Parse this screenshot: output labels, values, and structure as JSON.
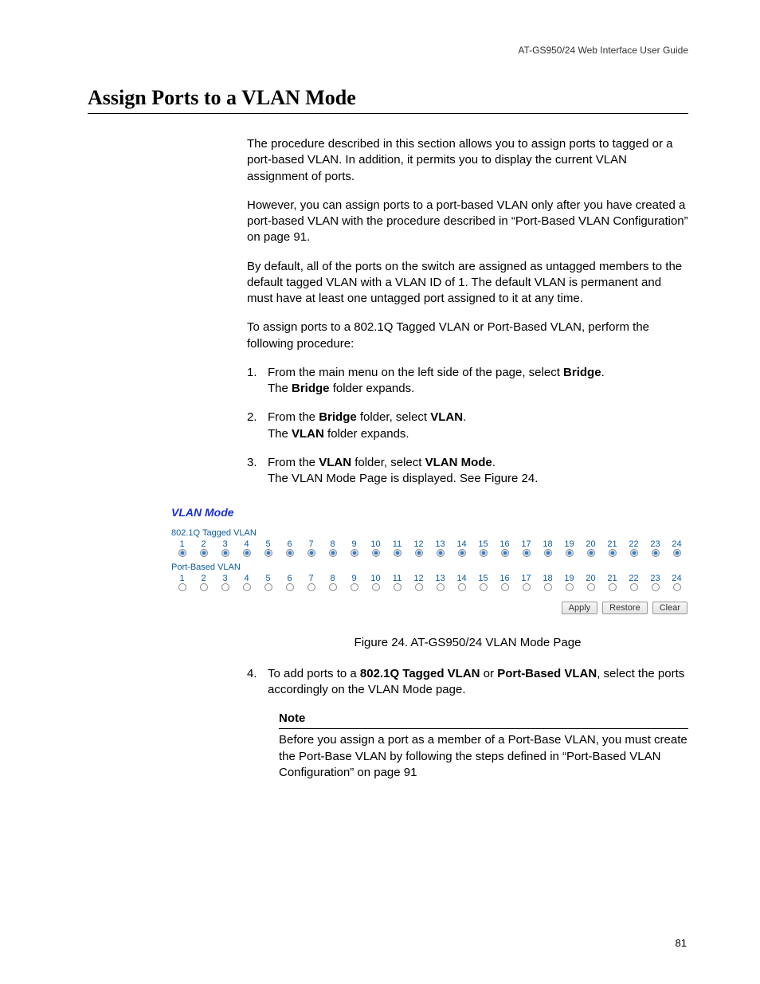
{
  "header": {
    "runhead": "AT-GS950/24  Web Interface User Guide"
  },
  "title": "Assign Ports to a VLAN Mode",
  "paras": {
    "p1": "The procedure described in this section allows you to assign ports to tagged or a port-based VLAN. In addition, it permits you to display the current VLAN assignment of ports.",
    "p2": "However, you can assign ports to a port-based VLAN only after you have created a port-based VLAN with the procedure described in “Port-Based VLAN Configuration” on page 91.",
    "p3": "By default, all of the ports on the switch are assigned as untagged members to the default tagged VLAN with a VLAN ID of 1. The default VLAN is permanent and must have at least one untagged port assigned to it at any time.",
    "p4": "To assign ports to a 802.1Q Tagged VLAN or Port-Based VLAN, perform the following procedure:"
  },
  "steps": {
    "s1_a": "From the main menu on the left side of the page, select ",
    "s1_b": "Bridge",
    "s1_c": ".",
    "s1_d": "The ",
    "s1_e": "Bridge",
    "s1_f": " folder expands.",
    "s2_a": "From the ",
    "s2_b": "Bridge",
    "s2_c": " folder, select ",
    "s2_d": "VLAN",
    "s2_e": ".",
    "s2_f": "The ",
    "s2_g": "VLAN",
    "s2_h": " folder expands.",
    "s3_a": "From the ",
    "s3_b": "VLAN",
    "s3_c": " folder, select ",
    "s3_d": "VLAN Mode",
    "s3_e": ".",
    "s3_f": "The VLAN Mode Page is displayed. See Figure 24.",
    "s4_a": "To add ports to a ",
    "s4_b": "802.1Q Tagged VLAN",
    "s4_c": " or ",
    "s4_d": "Port-Based VLAN",
    "s4_e": ", select the ports accordingly on the VLAN Mode page."
  },
  "figure": {
    "title": "VLAN Mode",
    "group1": "802.1Q Tagged VLAN",
    "group2": "Port-Based VLAN",
    "ports": [
      "1",
      "2",
      "3",
      "4",
      "5",
      "6",
      "7",
      "8",
      "9",
      "10",
      "11",
      "12",
      "13",
      "14",
      "15",
      "16",
      "17",
      "18",
      "19",
      "20",
      "21",
      "22",
      "23",
      "24"
    ],
    "buttons": {
      "apply": "Apply",
      "restore": "Restore",
      "clear": "Clear"
    },
    "caption": "Figure 24. AT-GS950/24 VLAN Mode Page"
  },
  "note": {
    "head": "Note",
    "body": "Before you assign a port as a member of a Port-Base VLAN, you must create the Port-Base VLAN by following the steps defined in “Port-Based VLAN Configuration” on page 91"
  },
  "pagenum": "81"
}
